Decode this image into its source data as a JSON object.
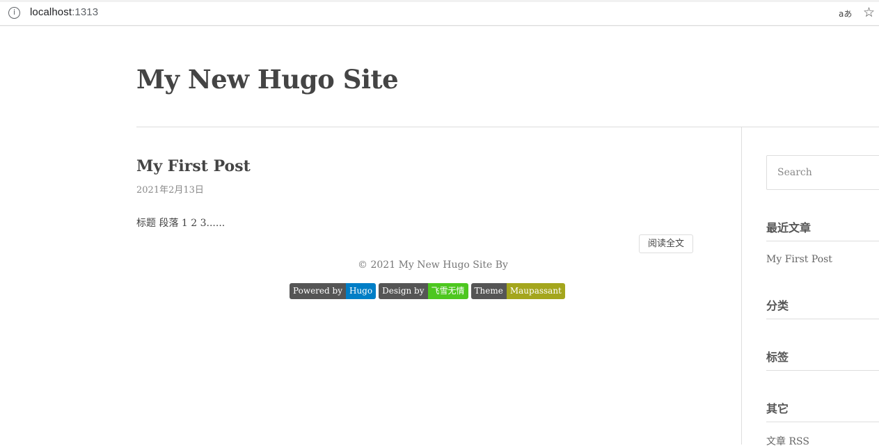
{
  "browser": {
    "url_host": "localhost",
    "url_port": ":1313",
    "info_icon": "info-icon",
    "read_aloud_glyph": "aあ",
    "favorite_icon": "star-add-icon"
  },
  "site": {
    "title": "My New Hugo Site"
  },
  "post": {
    "title": "My First Post",
    "date": "2021年2月13日",
    "excerpt": "标题 段落 1 2 3......",
    "read_more": "阅读全文"
  },
  "footer": {
    "copyright": "© 2021 My New Hugo Site By",
    "badges": [
      {
        "left": "Powered by",
        "right": "Hugo",
        "right_color": "#007ec6"
      },
      {
        "left": "Design by",
        "right": "飞雪无情",
        "right_color": "#4dc71f"
      },
      {
        "left": "Theme",
        "right": "Maupassant",
        "right_color": "#a4a61d"
      }
    ]
  },
  "sidebar": {
    "search_placeholder": "Search",
    "widgets": [
      {
        "title": "最近文章",
        "links": [
          "My First Post"
        ]
      },
      {
        "title": "分类",
        "links": []
      },
      {
        "title": "标签",
        "links": []
      },
      {
        "title": "其它",
        "links": [
          "文章 RSS"
        ]
      }
    ]
  }
}
